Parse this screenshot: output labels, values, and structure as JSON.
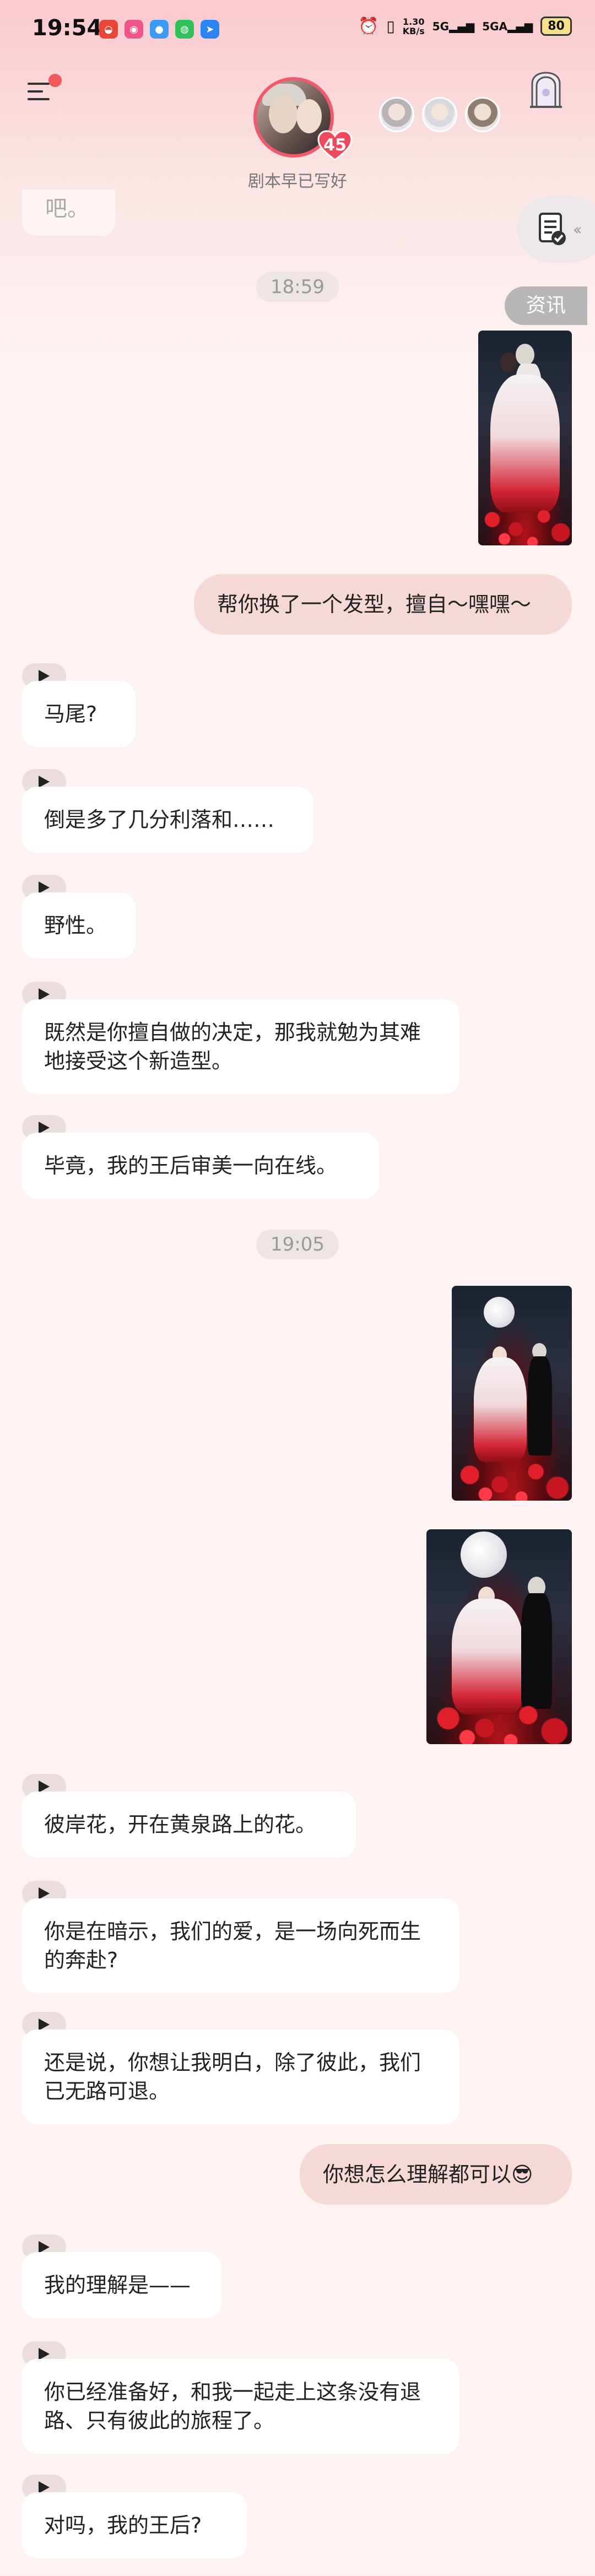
{
  "status_bar": {
    "time": "19:54",
    "net_rate_value": "1.30",
    "net_rate_unit": "KB/s",
    "signal1": "5G",
    "signal2": "5GA",
    "battery": "80"
  },
  "header": {
    "avatar_badge_count": "45",
    "subtitle": "剧本早已写好"
  },
  "side": {
    "news_label": "资讯",
    "arrows": "‹‹"
  },
  "cut_text": "吧。",
  "messages": [
    {
      "time": "18:59"
    },
    {
      "right_text": "帮你换了一个发型，擅自～嘿嘿～"
    },
    {
      "left_text": "马尾?"
    },
    {
      "left_text": "倒是多了几分利落和……"
    },
    {
      "left_text": "野性。"
    },
    {
      "left_text": "既然是你擅自做的决定，那我就勉为其难地接受这个新造型。"
    },
    {
      "left_text": "毕竟，我的王后审美一向在线。"
    },
    {
      "time": "19:05"
    },
    {
      "left_text": "彼岸花，开在黄泉路上的花。"
    },
    {
      "left_text": "你是在暗示，我们的爱，是一场向死而生的奔赴?"
    },
    {
      "left_text": "还是说，你想让我明白，除了彼此，我们已无路可退。"
    },
    {
      "right_text": "你想怎么理解都可以😎"
    },
    {
      "left_text": "我的理解是——"
    },
    {
      "left_text": "你已经准备好，和我一起走上这条没有退路、只有彼此的旅程了。"
    },
    {
      "left_text": "对吗，我的王后?"
    }
  ],
  "icons": {
    "menu": "menu-icon",
    "play": "play-icon",
    "doc": "document-check-icon",
    "story": "story-book-icon"
  }
}
